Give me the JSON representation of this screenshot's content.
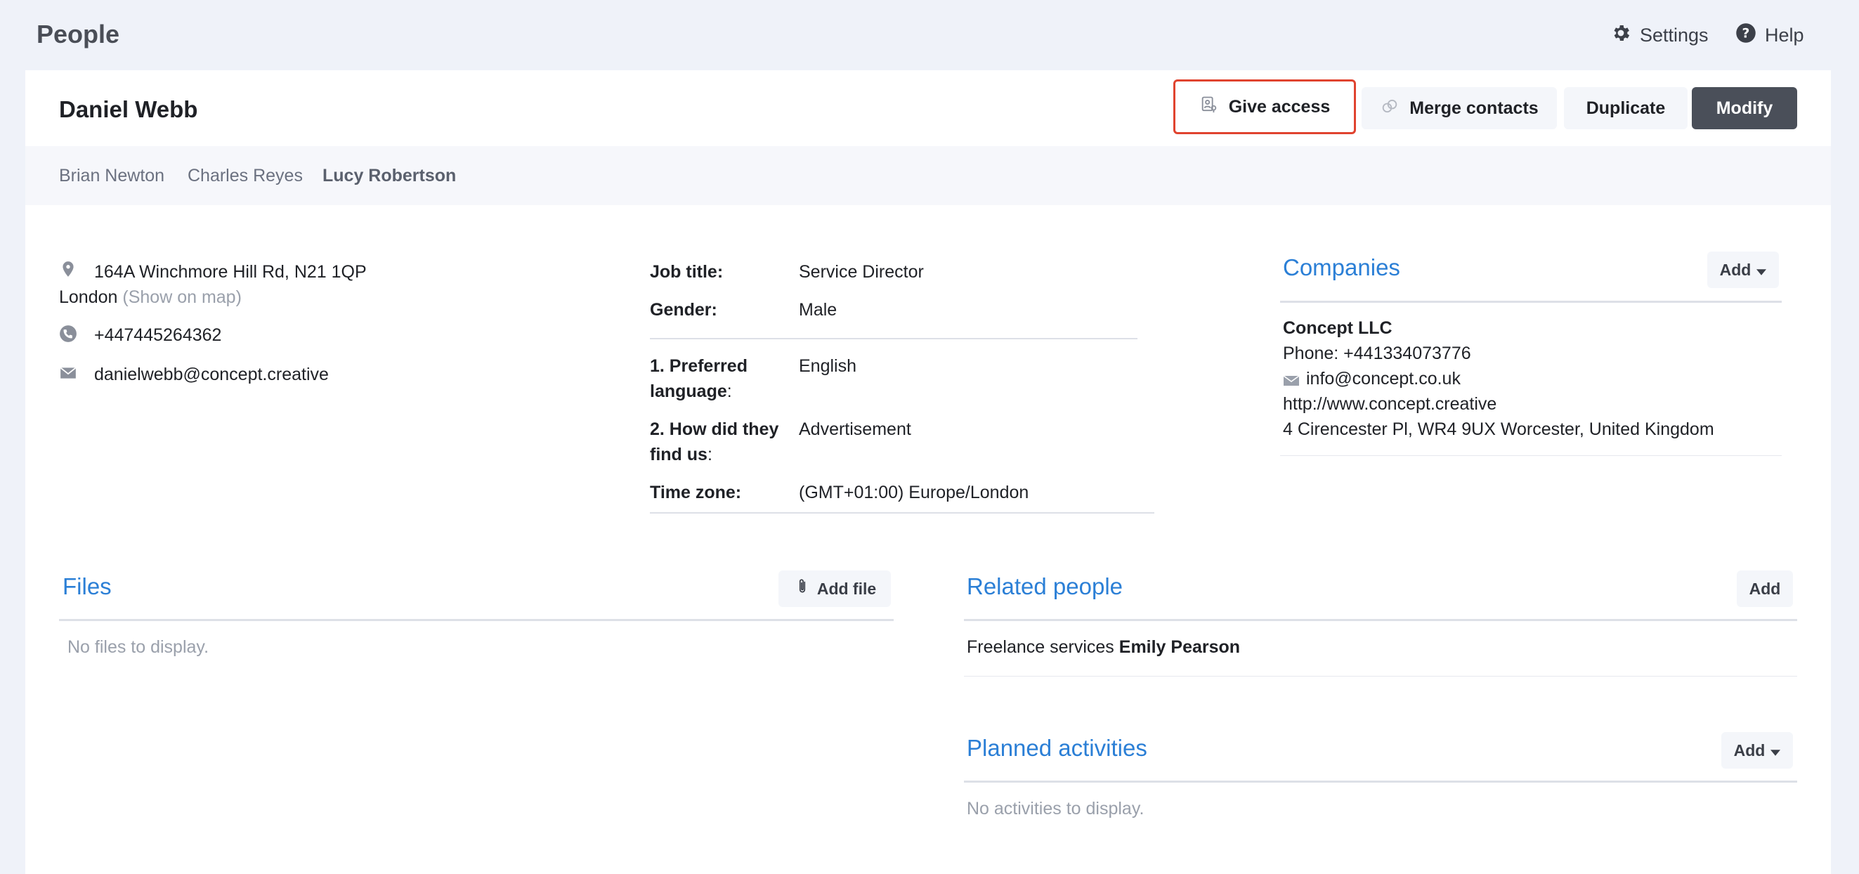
{
  "header": {
    "title": "People",
    "settings_label": "Settings",
    "help_label": "Help"
  },
  "person": {
    "name": "Daniel Webb"
  },
  "actions": {
    "give_access": "Give access",
    "merge_contacts": "Merge contacts",
    "duplicate": "Duplicate",
    "modify": "Modify"
  },
  "tabs": [
    {
      "label": "Brian Newton"
    },
    {
      "label": "Charles Reyes"
    },
    {
      "label": "Lucy Robertson"
    }
  ],
  "contact": {
    "address_line1": "164A Winchmore Hill Rd, N21 1QP",
    "address_line2": "London",
    "show_on_map": "(Show on map)",
    "phone": "+447445264362",
    "email": "danielwebb@concept.creative"
  },
  "details": {
    "job_title_label": "Job title:",
    "job_title_value": "Service Director",
    "gender_label": "Gender:",
    "gender_value": "Male",
    "preferred_language_label_1": "1. Preferred",
    "preferred_language_label_2": "language",
    "preferred_language_value": "English",
    "how_found_label_1": "2. How did they",
    "how_found_label_2": "find us",
    "how_found_value": "Advertisement",
    "time_zone_label": "Time zone:",
    "time_zone_value": "(GMT+01:00) Europe/London"
  },
  "companies": {
    "title": "Companies",
    "add_label": "Add",
    "company_name": "Concept LLC",
    "phone": "Phone: +441334073776",
    "email": "info@concept.co.uk",
    "website": "http://www.concept.creative",
    "address": "4 Cirencester Pl, WR4 9UX Worcester, United Kingdom"
  },
  "files": {
    "title": "Files",
    "add_label": "Add file",
    "empty": "No files to display."
  },
  "related_people": {
    "title": "Related people",
    "add_label": "Add",
    "relation": "Freelance services",
    "person": "Emily Pearson"
  },
  "planned_activities": {
    "title": "Planned activities",
    "add_label": "Add",
    "empty": "No activities to display."
  },
  "colors": {
    "accent": "#2b7fd6",
    "highlight": "#e0432f",
    "primary_button": "#4a4f59"
  }
}
